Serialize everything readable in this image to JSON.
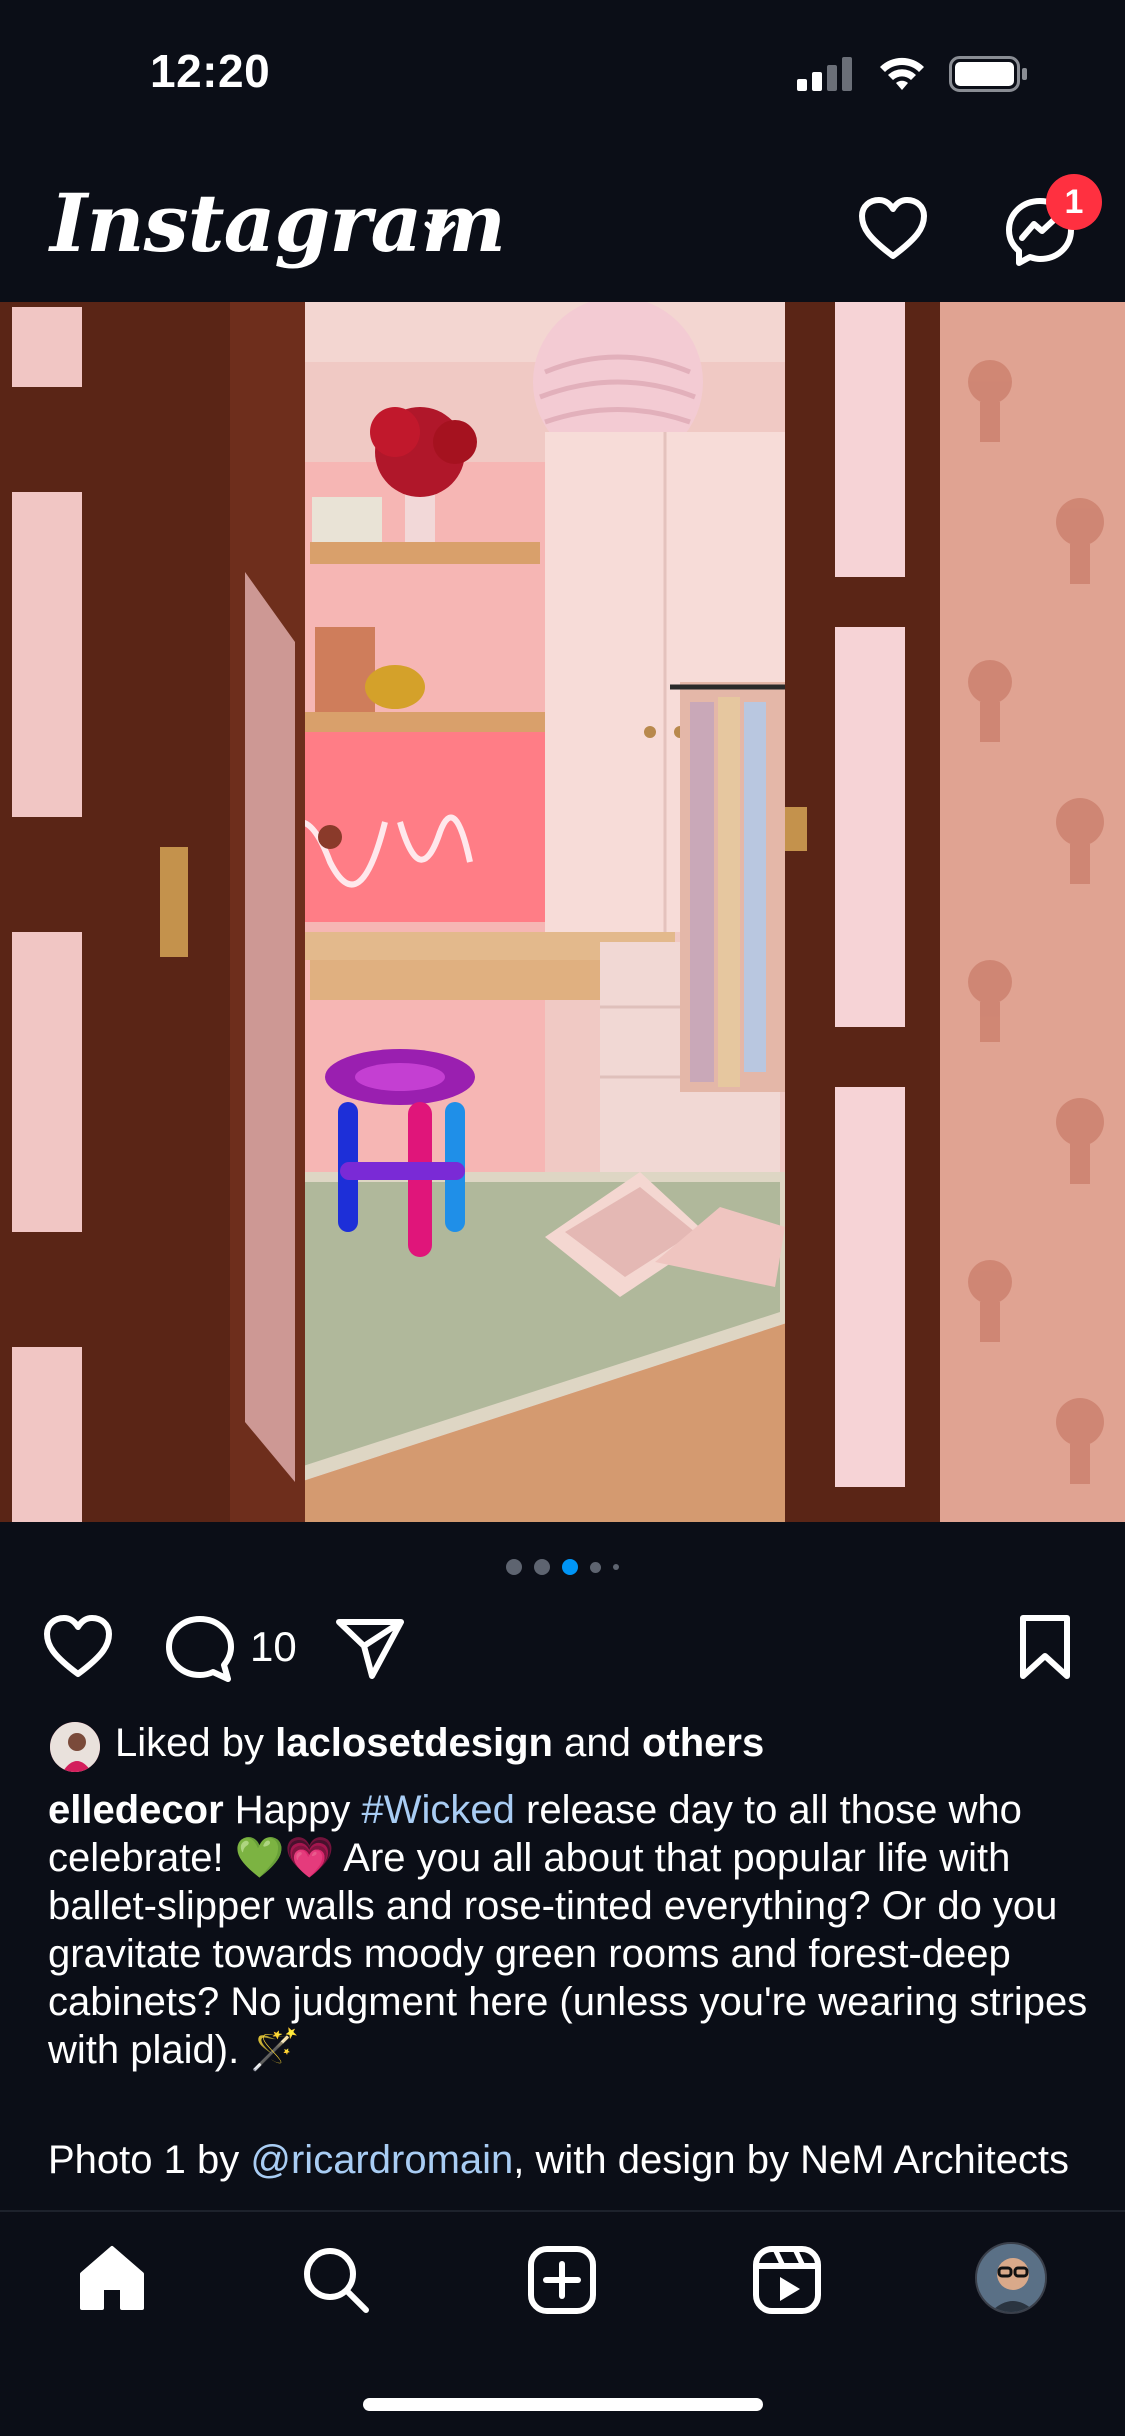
{
  "status_bar": {
    "time": "12:20"
  },
  "header": {
    "app_name": "Instagram",
    "notification_count": "1"
  },
  "post": {
    "carousel": {
      "total": 5,
      "active_index": 2
    },
    "comment_count": "10",
    "liked_by": {
      "prefix": "Liked by",
      "user": "laclosetdesign",
      "connector": "and",
      "suffix": "others"
    },
    "caption": {
      "username": "elledecor",
      "text_before": "Happy",
      "hashtag": "#Wicked",
      "text_after": "release day to all those who celebrate! 💚💗 Are you all about that popular life with ballet-slipper walls and rose-tinted everything? Or do you gravitate towards moody green rooms and forest-deep cabinets? No judgment here (unless you're wearing stripes with plaid). 🪄"
    },
    "credit": {
      "prefix": "Photo 1 by",
      "mention": "@ricardromain",
      "suffix": ", with design by NeM Architects"
    }
  },
  "colors": {
    "background": "#0b0e17",
    "accent": "#0095f6",
    "badge": "#ff3040",
    "link": "#a9cdf4"
  }
}
